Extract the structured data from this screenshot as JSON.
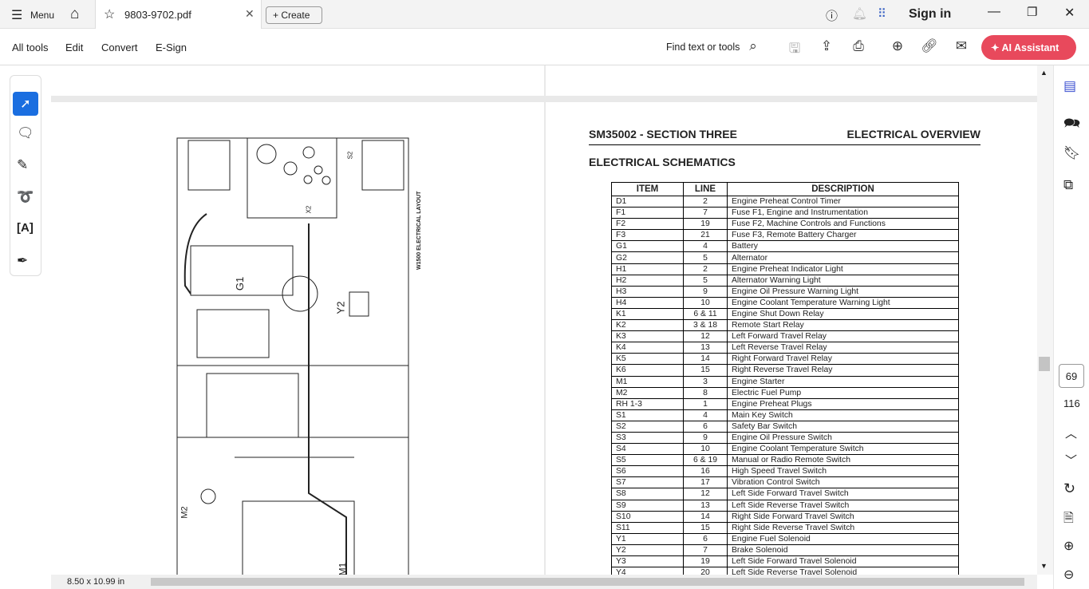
{
  "tabbar": {
    "menu": "Menu",
    "tab_title": "9803-9702.pdf",
    "create": "Create",
    "sign_in": "Sign in"
  },
  "toolbar": {
    "all_tools": "All tools",
    "edit": "Edit",
    "convert": "Convert",
    "esign": "E-Sign",
    "find": "Find text or tools",
    "ai": "AI Assistant",
    "ai_color": "#e8495c"
  },
  "page": {
    "header_left": "SM35002 - SECTION THREE",
    "header_right": "ELECTRICAL OVERVIEW",
    "subtitle": "ELECTRICAL SCHEMATICS",
    "layout_label": "W1500 ELECTRICAL LAYOUT",
    "labels": {
      "g1": "G1",
      "y2": "Y2",
      "m2": "M2",
      "m1": "M1",
      "x2": "X2",
      "s2": "S2"
    }
  },
  "table": {
    "headers": [
      "ITEM",
      "LINE",
      "DESCRIPTION"
    ],
    "rows": [
      [
        "D1",
        "2",
        "Engine Preheat Control Timer"
      ],
      [
        "F1",
        "7",
        "Fuse F1, Engine and Instrumentation"
      ],
      [
        "F2",
        "19",
        "Fuse F2, Machine Controls and Functions"
      ],
      [
        "F3",
        "21",
        "Fuse F3, Remote Battery Charger"
      ],
      [
        "G1",
        "4",
        "Battery"
      ],
      [
        "G2",
        "5",
        "Alternator"
      ],
      [
        "H1",
        "2",
        "Engine Preheat Indicator Light"
      ],
      [
        "H2",
        "5",
        "Alternator Warning Light"
      ],
      [
        "H3",
        "9",
        "Engine Oil Pressure Warning Light"
      ],
      [
        "H4",
        "10",
        "Engine Coolant Temperature Warning Light"
      ],
      [
        "K1",
        "6 & 11",
        "Engine Shut Down Relay"
      ],
      [
        "K2",
        "3 & 18",
        "Remote Start Relay"
      ],
      [
        "K3",
        "12",
        "Left Forward Travel Relay"
      ],
      [
        "K4",
        "13",
        "Left Reverse Travel Relay"
      ],
      [
        "K5",
        "14",
        "Right Forward Travel Relay"
      ],
      [
        "K6",
        "15",
        "Right Reverse Travel Relay"
      ],
      [
        "M1",
        "3",
        "Engine Starter"
      ],
      [
        "M2",
        "8",
        "Electric Fuel Pump"
      ],
      [
        "RH 1-3",
        "1",
        "Engine Preheat Plugs"
      ],
      [
        "S1",
        "4",
        "Main Key Switch"
      ],
      [
        "S2",
        "6",
        "Safety Bar Switch"
      ],
      [
        "S3",
        "9",
        "Engine Oil Pressure Switch"
      ],
      [
        "S4",
        "10",
        "Engine Coolant Temperature Switch"
      ],
      [
        "S5",
        "6 & 19",
        "Manual or Radio Remote Switch"
      ],
      [
        "S6",
        "16",
        "High Speed Travel Switch"
      ],
      [
        "S7",
        "17",
        "Vibration Control Switch"
      ],
      [
        "S8",
        "12",
        "Left Side Forward Travel Switch"
      ],
      [
        "S9",
        "13",
        "Left Side Reverse Travel Switch"
      ],
      [
        "S10",
        "14",
        "Right Side Forward Travel Switch"
      ],
      [
        "S11",
        "15",
        "Right Side Reverse Travel Switch"
      ],
      [
        "Y1",
        "6",
        "Engine Fuel Solenoid"
      ],
      [
        "Y2",
        "7",
        "Brake Solenoid"
      ],
      [
        "Y3",
        "19",
        "Left Side Forward Travel Solenoid"
      ],
      [
        "Y4",
        "20",
        "Left Side Reverse Travel Solenoid"
      ]
    ]
  },
  "nav": {
    "current_page": "69",
    "total_pages": "116"
  },
  "status": {
    "page_size": "8.50 x 10.99 in"
  }
}
